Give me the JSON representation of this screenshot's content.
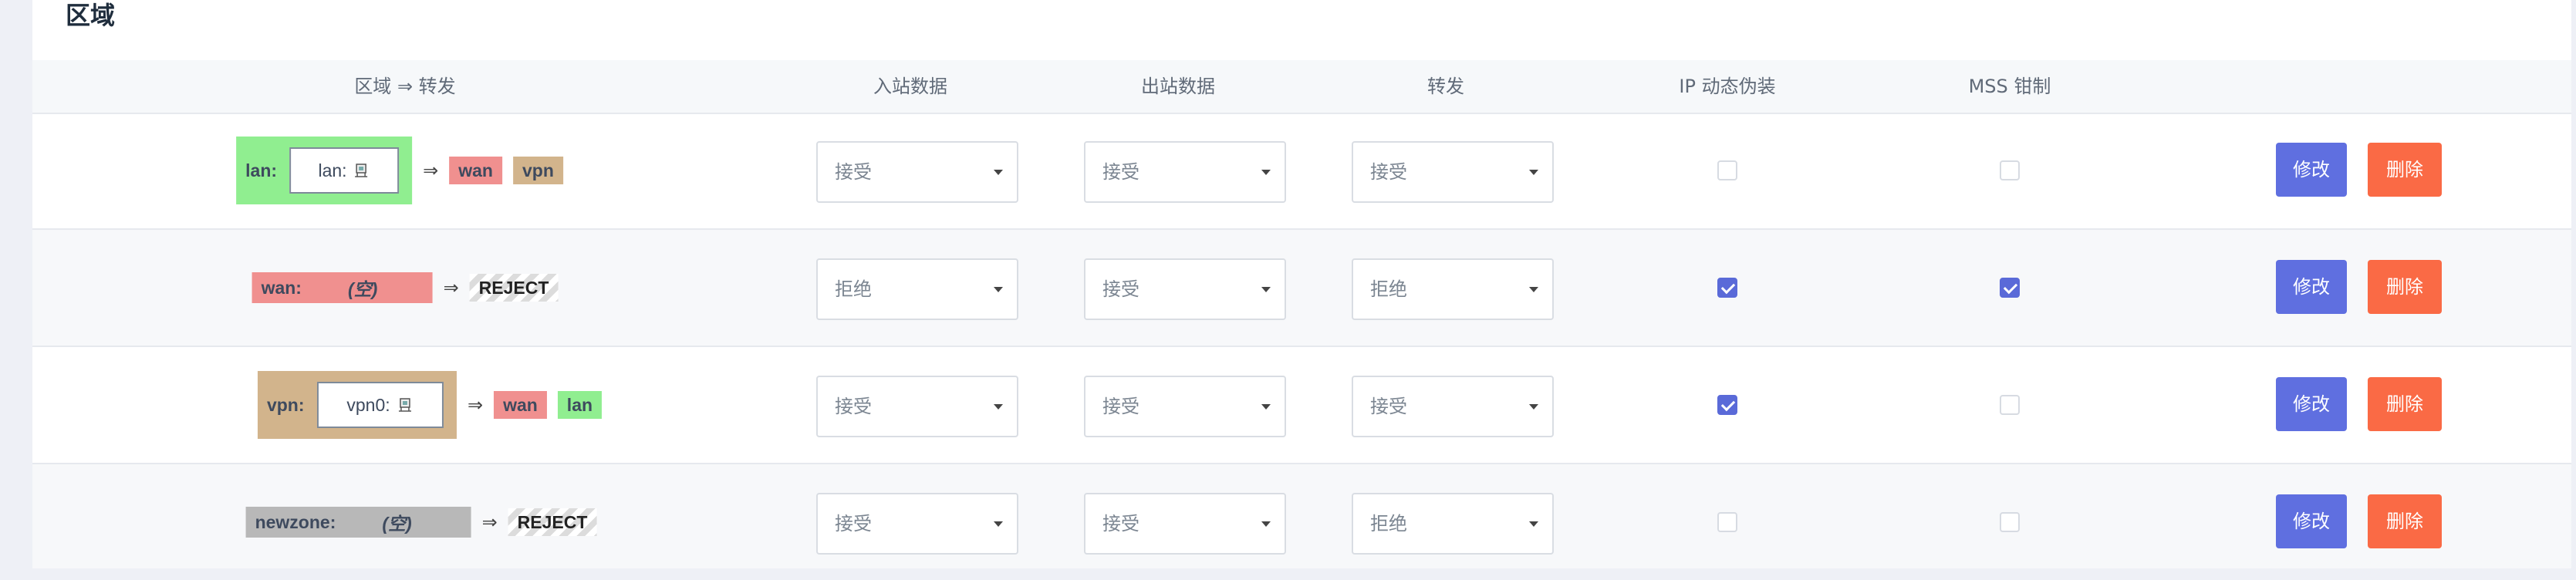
{
  "section": {
    "title": "区域"
  },
  "header": {
    "zone_forward": "区域 ⇒ 转发",
    "input": "入站数据",
    "output": "出站数据",
    "forward": "转发",
    "masq": "IP 动态伪装",
    "mss": "MSS 钳制"
  },
  "colors": {
    "lan": "#90ee90",
    "wan": "#f0908f",
    "vpn": "#d2b48c",
    "newzone": "#b8b8b8",
    "edit_button": "#5f6fe0",
    "delete_button": "#fa6a45",
    "checkbox_checked": "#5a6ad8"
  },
  "arrow": "⇒",
  "rows": [
    {
      "zone_label": "lan:",
      "interface": "lan:",
      "interface_icon": "network-port-icon",
      "forwards": [
        "wan",
        "vpn"
      ],
      "input": "接受",
      "output": "接受",
      "forward": "接受",
      "masq": false,
      "mss": false,
      "edit": "修改",
      "delete": "删除"
    },
    {
      "zone_label": "wan:",
      "empty": "(空)",
      "forwards_reject": "REJECT",
      "input": "拒绝",
      "output": "接受",
      "forward": "拒绝",
      "masq": true,
      "mss": true,
      "edit": "修改",
      "delete": "删除"
    },
    {
      "zone_label": "vpn:",
      "interface": "vpn0:",
      "interface_icon": "network-port-icon",
      "forwards": [
        "wan",
        "lan"
      ],
      "input": "接受",
      "output": "接受",
      "forward": "接受",
      "masq": true,
      "mss": false,
      "edit": "修改",
      "delete": "删除"
    },
    {
      "zone_label": "newzone:",
      "empty": "(空)",
      "forwards_reject": "REJECT",
      "input": "接受",
      "output": "接受",
      "forward": "拒绝",
      "masq": false,
      "mss": false,
      "edit": "修改",
      "delete": "删除"
    }
  ]
}
